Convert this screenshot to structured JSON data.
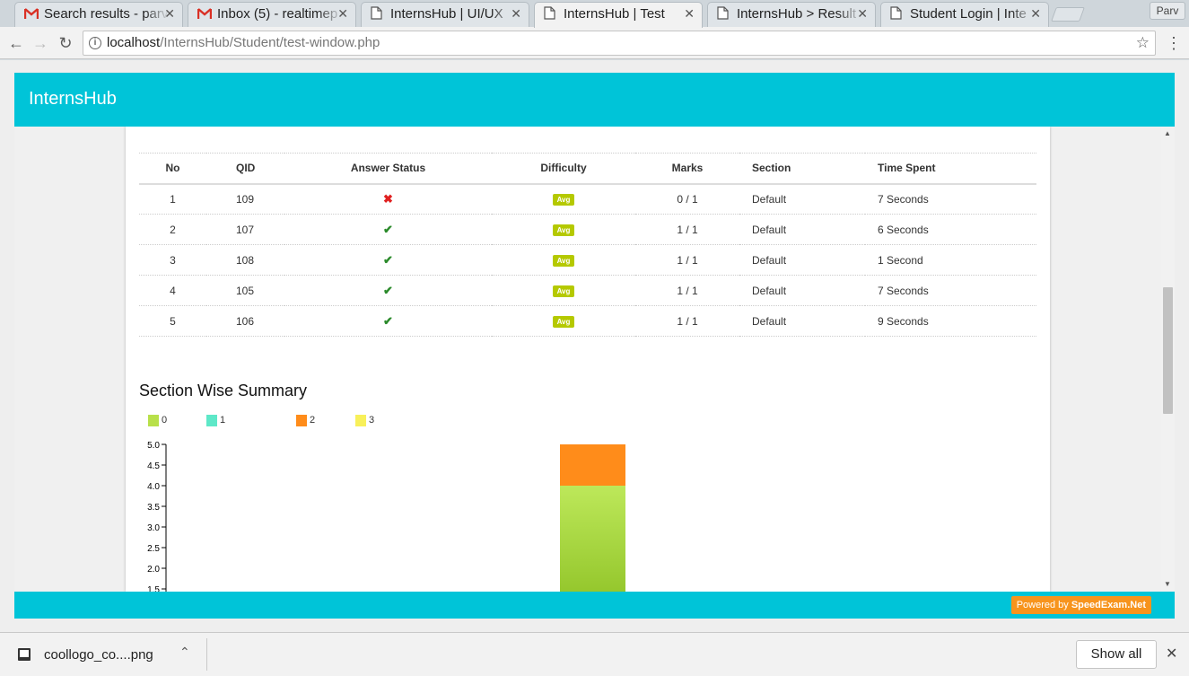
{
  "browser": {
    "tabs": [
      {
        "title": "Search results - parv",
        "favicon": "gmail-icon",
        "active": false
      },
      {
        "title": "Inbox (5) - realtimep",
        "favicon": "gmail-icon",
        "active": false
      },
      {
        "title": "InternsHub | UI/UX",
        "favicon": "page-icon",
        "active": false
      },
      {
        "title": "InternsHub | Test",
        "favicon": "page-icon",
        "active": true
      },
      {
        "title": "InternsHub > Result",
        "favicon": "page-icon",
        "active": false
      },
      {
        "title": "Student Login | Inte",
        "favicon": "page-icon",
        "active": false
      }
    ],
    "profile_name": "Parv",
    "url_host": "localhost",
    "url_path": "/InternsHub/Student/test-window.php"
  },
  "app": {
    "brand": "InternsHub",
    "header_color": "#00c4d8"
  },
  "results_table": {
    "headers": {
      "no": "No",
      "qid": "QID",
      "status": "Answer Status",
      "difficulty": "Difficulty",
      "marks": "Marks",
      "section": "Section",
      "time": "Time Spent"
    },
    "rows": [
      {
        "no": "1",
        "qid": "109",
        "status": "wrong",
        "status_symbol": "✖",
        "difficulty": "Avg",
        "marks": "0 / 1",
        "section": "Default",
        "time": "7 Seconds"
      },
      {
        "no": "2",
        "qid": "107",
        "status": "correct",
        "status_symbol": "✔",
        "difficulty": "Avg",
        "marks": "1 / 1",
        "section": "Default",
        "time": "6 Seconds"
      },
      {
        "no": "3",
        "qid": "108",
        "status": "correct",
        "status_symbol": "✔",
        "difficulty": "Avg",
        "marks": "1 / 1",
        "section": "Default",
        "time": "1 Second"
      },
      {
        "no": "4",
        "qid": "105",
        "status": "correct",
        "status_symbol": "✔",
        "difficulty": "Avg",
        "marks": "1 / 1",
        "section": "Default",
        "time": "7 Seconds"
      },
      {
        "no": "5",
        "qid": "106",
        "status": "correct",
        "status_symbol": "✔",
        "difficulty": "Avg",
        "marks": "1 / 1",
        "section": "Default",
        "time": "9 Seconds"
      }
    ]
  },
  "summary": {
    "title": "Section Wise Summary"
  },
  "chart_data": {
    "type": "bar",
    "stacked": true,
    "categories": [
      ""
    ],
    "series": [
      {
        "name": "0",
        "color": "#b8e04a",
        "values": [
          4
        ]
      },
      {
        "name": "1",
        "color": "#5ee8c8",
        "values": [
          0
        ]
      },
      {
        "name": "2",
        "color": "#ff8c1a",
        "values": [
          1
        ]
      },
      {
        "name": "3",
        "color": "#f8f05a",
        "values": [
          0
        ]
      }
    ],
    "ylim": [
      1.5,
      5.0
    ],
    "yticks": [
      "5.0",
      "4.5",
      "4.0",
      "3.5",
      "3.0",
      "2.5",
      "2.0",
      "1.5"
    ],
    "legend_position": "top-left"
  },
  "footer": {
    "powered_prefix": "Powered by",
    "powered_brand": "SpeedExam.Net"
  },
  "downloads": {
    "file_name": "coollogo_co....png",
    "show_all_label": "Show all"
  }
}
